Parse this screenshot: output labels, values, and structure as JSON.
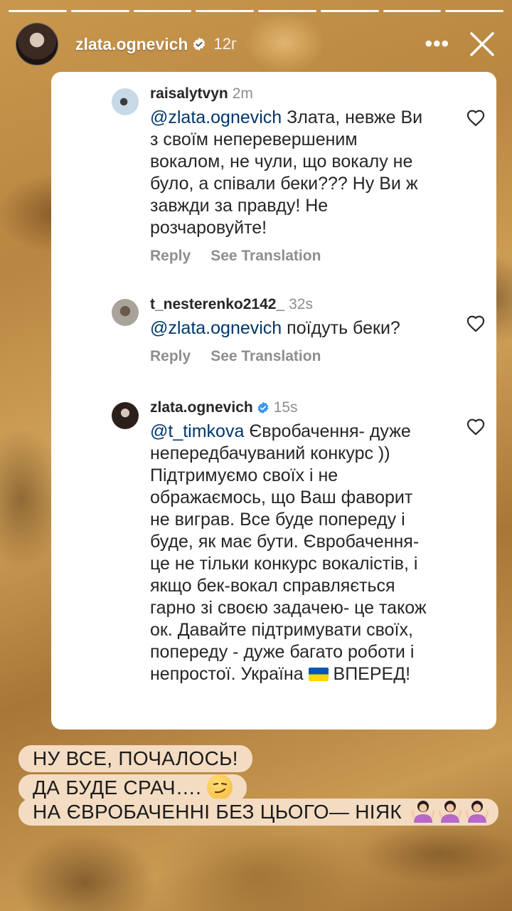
{
  "story": {
    "segments": 8,
    "username": "zlata.ognevich",
    "time": "12г"
  },
  "comments": [
    {
      "username": "raisalytvyn",
      "time": "2m",
      "mention": "@zlata.ognevich",
      "text": " Злата, невже Ви з своїм неперевершеним вокалом, не чули, що вокалу не було, а співали беки??? Ну Ви ж завжди за правду! Не розчаровуйте!",
      "reply_label": "Reply",
      "translate_label": "See Translation",
      "verified": false
    },
    {
      "username": "t_nesterenko2142_",
      "time": "32s",
      "mention": "@zlata.ognevich",
      "text": " поїдуть беки?",
      "reply_label": "Reply",
      "translate_label": "See Translation",
      "verified": false
    },
    {
      "username": "zlata.ognevich",
      "time": "15s",
      "mention": "@t_timkova",
      "text": " Євробачення- дуже непередбачуваний конкурс )) Підтримуємо своїх і не ображаємось, що Ваш фаворит не виграв. Все буде попереду і буде, як має бути. Євробачення- це не тільки конкурс вокалістів, і якщо бек-вокал справляється гарно зі своєю задачею- це також ок. Давайте підтримувати своїх, попереду - дуже багато роботи і непростої. Україна",
      "text_end": "ВПЕРЕД!",
      "verified": true
    }
  ],
  "caption": {
    "line1": "НУ ВСЕ, ПОЧАЛОСЬ!",
    "line2": "ДА БУДЕ СРАЧ….",
    "line3": "НА ЄВРОБАЧЕННІ БЕЗ ЦЬОГО— НІЯК"
  },
  "colors": {
    "mention": "#00376b",
    "verified": "#3897f0",
    "sticker_bg": "#f3dcc2"
  },
  "icons": [
    "more-icon",
    "close-icon",
    "heart-icon",
    "verified-badge-icon",
    "ukraine-flag-icon",
    "smirk-emoji-icon",
    "shrug-emoji-icon"
  ]
}
